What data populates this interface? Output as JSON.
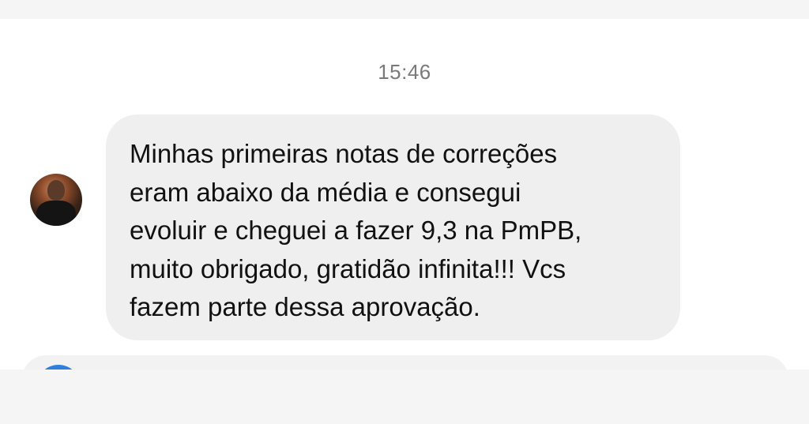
{
  "chat": {
    "timestamp": "15:46",
    "messages": [
      {
        "sender": "incoming",
        "text": "Minhas primeiras notas de correções\neram abaixo da média e consegui\nevoluir e cheguei a fazer 9,3 na PmPB,\nmuito obrigado, gratidão infinita!!! Vcs\nfazem parte dessa aprovação."
      }
    ]
  },
  "colors": {
    "bubble_incoming": "#efefef",
    "timestamp_text": "#7a7a7a",
    "message_text": "#111111",
    "next_avatar_accent": "#2f7fe0"
  },
  "icons": {
    "sender_avatar": "avatar-photo",
    "next_sender_avatar": "avatar-photo"
  }
}
